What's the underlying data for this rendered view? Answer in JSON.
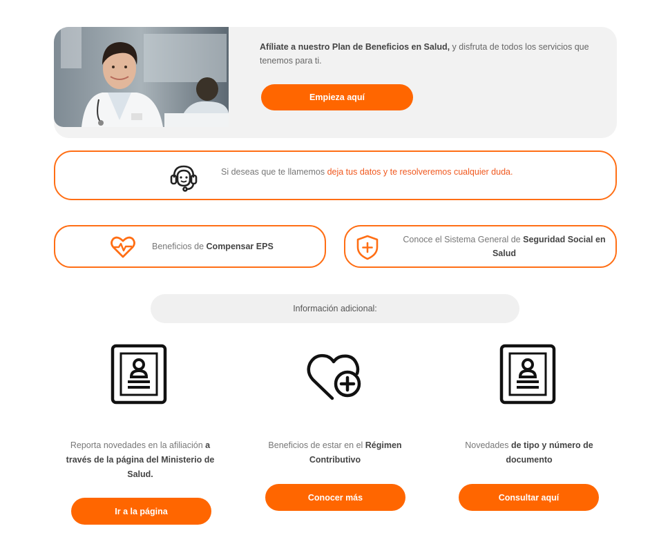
{
  "hero": {
    "bold_text": "Afíliate a nuestro Plan de Beneficios en Salud,",
    "rest_text": " y disfruta de todos los servicios que tenemos para ti.",
    "button_label": "Empieza aquí"
  },
  "callback": {
    "icon": "headset-icon",
    "prefix": "Si deseas que te llamemos ",
    "highlight": "deja tus datos y te resolveremos cualquier duda."
  },
  "benefits_pill": {
    "icon": "heart-pulse-icon",
    "prefix": "Beneficios de ",
    "bold": "Compensar EPS"
  },
  "system_pill": {
    "icon": "shield-plus-icon",
    "prefix": "Conoce el Sistema General de ",
    "bold": "Seguridad Social en Salud"
  },
  "info_bar": {
    "label": "Información adicional:"
  },
  "cards": [
    {
      "icon": "id-card-icon",
      "text_plain": "Reporta novedades en la afiliación ",
      "text_bold": "a través de la página del Ministerio de Salud.",
      "text_suffix": "",
      "button_label": "Ir a la página"
    },
    {
      "icon": "heart-plus-icon",
      "text_plain": "Beneficios de estar en el ",
      "text_bold": "Régimen Contributivo",
      "text_suffix": "",
      "button_label": "Conocer más"
    },
    {
      "icon": "id-card-icon",
      "text_plain": "Novedades ",
      "text_bold": "de tipo y número de documento",
      "text_suffix": "",
      "button_label": "Consultar aquí"
    }
  ],
  "colors": {
    "accent": "#ff6600",
    "border": "#ff6e14",
    "highlight_text": "#f0581e",
    "panel": "#f2f2f2"
  }
}
